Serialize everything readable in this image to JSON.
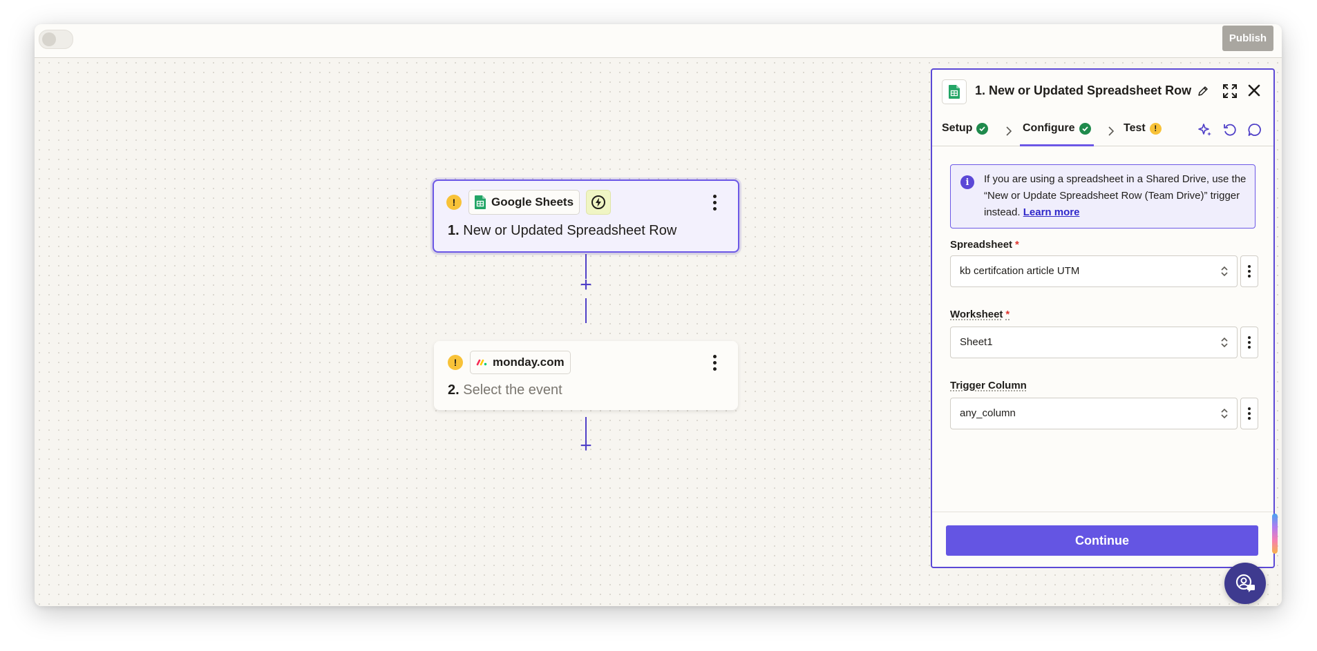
{
  "topbar": {
    "publish_label": "Publish"
  },
  "canvas": {
    "steps": [
      {
        "app_name": "Google Sheets",
        "number": "1.",
        "title": "New or Updated Spreadsheet Row",
        "status_icon": "warning-icon",
        "app_icon": "google-sheets-icon",
        "extra_icon": "bolt-icon"
      },
      {
        "app_name": "monday.com",
        "number": "2.",
        "title": "Select the event",
        "status_icon": "warning-icon",
        "app_icon": "monday-icon"
      }
    ],
    "add_step_symbol": "+"
  },
  "panel": {
    "title_number": "1.",
    "title": "New or Updated Spreadsheet Row",
    "tabs": [
      {
        "label": "Setup",
        "status": "complete"
      },
      {
        "label": "Configure",
        "status": "complete",
        "active": true
      },
      {
        "label": "Test",
        "status": "warning"
      }
    ],
    "info": {
      "text": "If you are using a spreadsheet in a Shared Drive, use the “New or Update Spreadsheet Row (Team Drive)” trigger instead. ",
      "link": "Learn more"
    },
    "fields": [
      {
        "label": "Spreadsheet",
        "required": "*",
        "value": "kb certifcation article UTM"
      },
      {
        "label": "Worksheet",
        "required": "*",
        "value": "Sheet1"
      },
      {
        "label": "Trigger Column",
        "required": "",
        "value": "any_column"
      }
    ],
    "continue_label": "Continue"
  },
  "colors": {
    "accent": "#6b57e6",
    "button": "#6455e3",
    "success": "#1f8a4c",
    "warning": "#f8c238"
  }
}
